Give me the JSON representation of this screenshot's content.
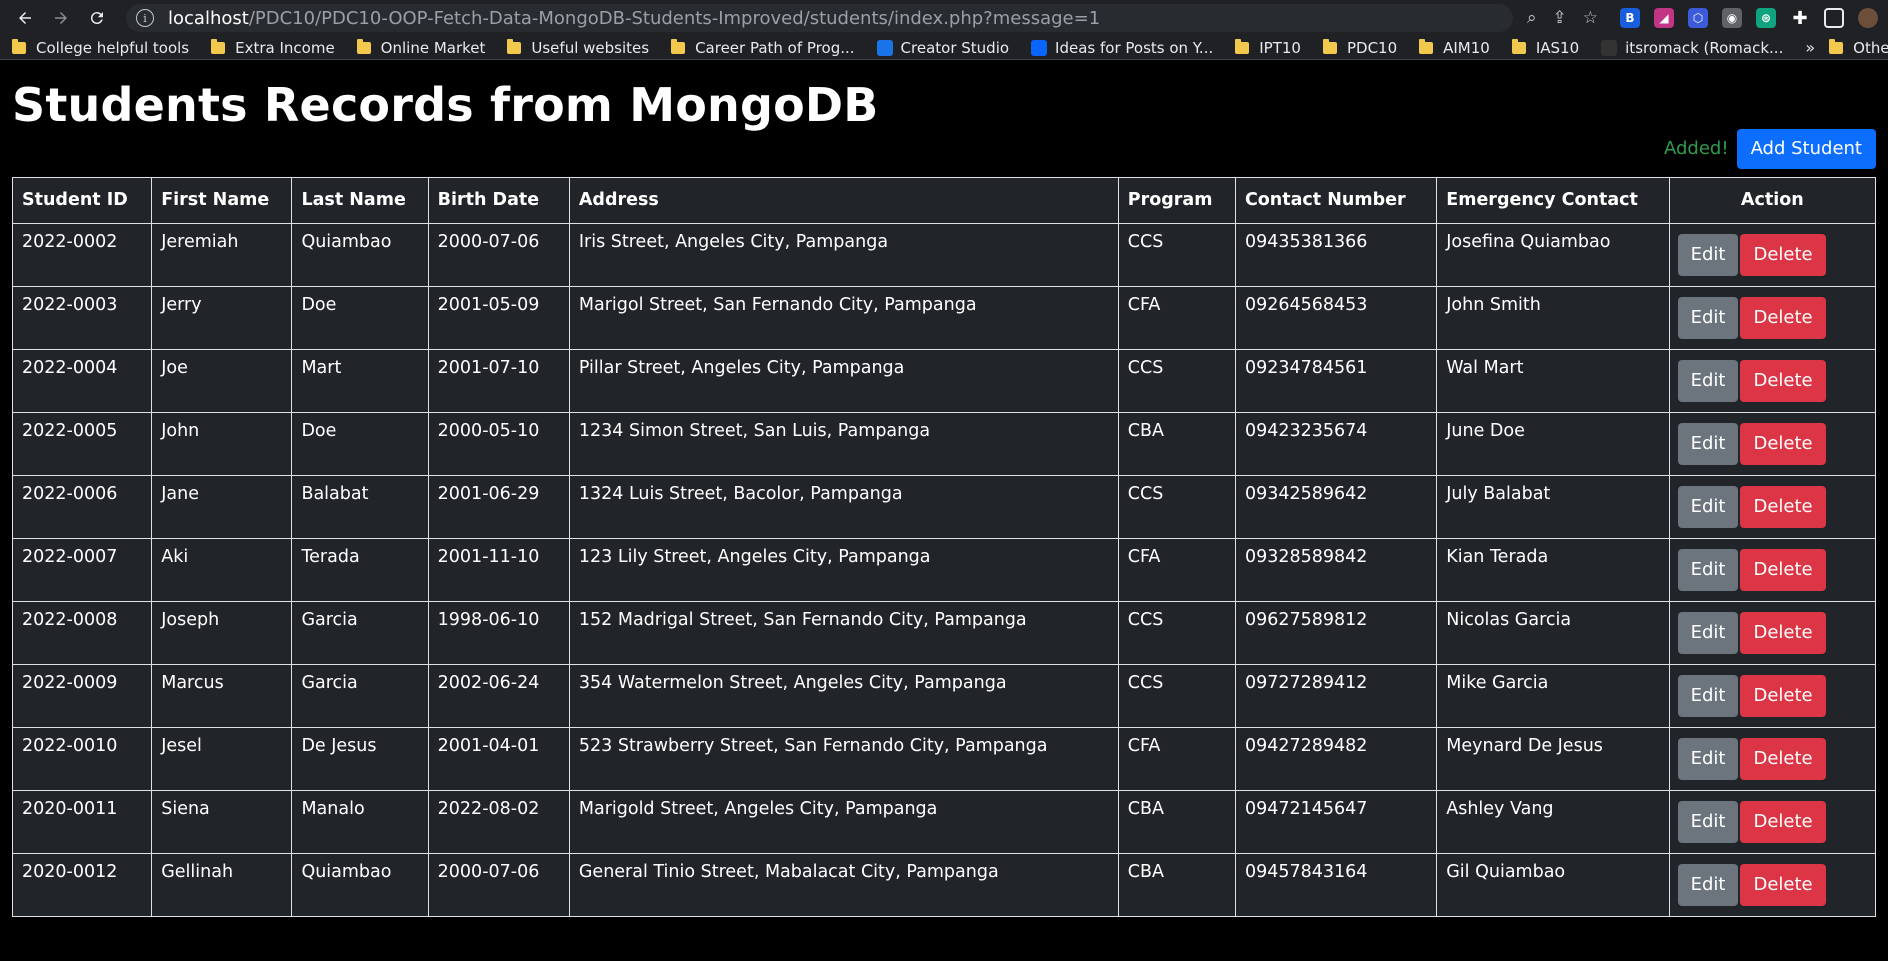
{
  "browser": {
    "url_host": "localhost",
    "url_path": "/PDC10/PDC10-OOP-Fetch-Data-MongoDB-Students-Improved/students/index.php?message=1",
    "bookmarks": [
      {
        "label": "College helpful tools",
        "type": "folder"
      },
      {
        "label": "Extra Income",
        "type": "folder"
      },
      {
        "label": "Online Market",
        "type": "folder"
      },
      {
        "label": "Useful websites",
        "type": "folder"
      },
      {
        "label": "Career Path of Prog...",
        "type": "folder"
      },
      {
        "label": "Creator Studio",
        "type": "site"
      },
      {
        "label": "Ideas for Posts on Y...",
        "type": "site"
      },
      {
        "label": "IPT10",
        "type": "folder"
      },
      {
        "label": "PDC10",
        "type": "folder"
      },
      {
        "label": "AIM10",
        "type": "folder"
      },
      {
        "label": "IAS10",
        "type": "folder"
      },
      {
        "label": "itsromack (Romack...",
        "type": "site"
      }
    ],
    "bookmarks_more": "»",
    "other_bookmarks": "Other bookmar"
  },
  "page": {
    "title": "Students Records from MongoDB",
    "message": "Added!",
    "add_button": "Add Student"
  },
  "table": {
    "headers": [
      "Student ID",
      "First Name",
      "Last Name",
      "Birth Date",
      "Address",
      "Program",
      "Contact Number",
      "Emergency Contact",
      "Action"
    ],
    "edit_label": "Edit",
    "delete_label": "Delete",
    "rows": [
      [
        "2022-0002",
        "Jeremiah",
        "Quiambao",
        "2000-07-06",
        "Iris Street, Angeles City, Pampanga",
        "CCS",
        "09435381366",
        "Josefina Quiambao"
      ],
      [
        "2022-0003",
        "Jerry",
        "Doe",
        "2001-05-09",
        "Marigol Street, San Fernando City, Pampanga",
        "CFA",
        "09264568453",
        "John Smith"
      ],
      [
        "2022-0004",
        "Joe",
        "Mart",
        "2001-07-10",
        "Pillar Street, Angeles City, Pampanga",
        "CCS",
        "09234784561",
        "Wal Mart"
      ],
      [
        "2022-0005",
        "John",
        "Doe",
        "2000-05-10",
        "1234 Simon Street, San Luis, Pampanga",
        "CBA",
        "09423235674",
        "June Doe"
      ],
      [
        "2022-0006",
        "Jane",
        "Balabat",
        "2001-06-29",
        "1324 Luis Street, Bacolor, Pampanga",
        "CCS",
        "09342589642",
        "July Balabat"
      ],
      [
        "2022-0007",
        "Aki",
        "Terada",
        "2001-11-10",
        "123 Lily Street, Angeles City, Pampanga",
        "CFA",
        "09328589842",
        "Kian Terada"
      ],
      [
        "2022-0008",
        "Joseph",
        "Garcia",
        "1998-06-10",
        "152 Madrigal Street, San Fernando City, Pampanga",
        "CCS",
        "09627589812",
        "Nicolas Garcia"
      ],
      [
        "2022-0009",
        "Marcus",
        "Garcia",
        "2002-06-24",
        "354 Watermelon Street, Angeles City, Pampanga",
        "CCS",
        "09727289412",
        "Mike Garcia"
      ],
      [
        "2022-0010",
        "Jesel",
        "De Jesus",
        "2001-04-01",
        "523 Strawberry Street, San Fernando City, Pampanga",
        "CFA",
        "09427289482",
        "Meynard De Jesus"
      ],
      [
        "2020-0011",
        "Siena",
        "Manalo",
        "2022-08-02",
        "Marigold Street, Angeles City, Pampanga",
        "CBA",
        "09472145647",
        "Ashley Vang"
      ],
      [
        "2020-0012",
        "Gellinah",
        "Quiambao",
        "2000-07-06",
        "General Tinio Street, Mabalacat City, Pampanga",
        "CBA",
        "09457843164",
        "Gil Quiambao"
      ]
    ]
  }
}
